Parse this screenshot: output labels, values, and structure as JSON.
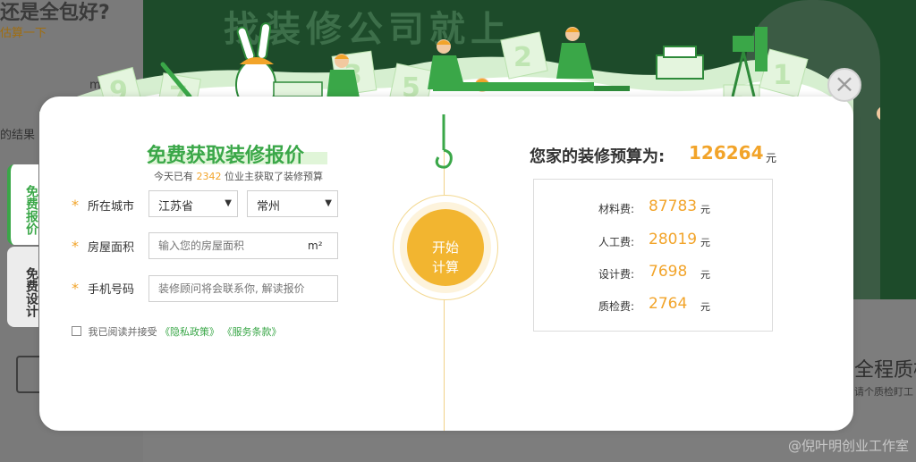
{
  "background": {
    "title": "还是全包好?",
    "subtitle": "估算一下",
    "area_unit": "m²",
    "result_text": "的结果",
    "banner_text": "找装修公司就上",
    "quality_title": "全程质检",
    "quality_sub": "请个质检盯工",
    "watermark": "@倪叶明创业工作室"
  },
  "side_tabs": [
    {
      "label": "免费报价"
    },
    {
      "label": "免费设计"
    }
  ],
  "form": {
    "title": "免费获取装修报价",
    "sub_prefix": "今天已有",
    "sub_count": "2342",
    "sub_suffix": "位业主获取了装修预算",
    "city_label": "所在城市",
    "province_value": "江苏省",
    "city_value": "常州",
    "area_label": "房屋面积",
    "area_placeholder": "输入您的房屋面积",
    "area_unit": "m²",
    "phone_label": "手机号码",
    "phone_placeholder": "装修顾问将会联系你, 解读报价",
    "agree_text": "我已阅读并接受",
    "privacy_link": "《隐私政策》",
    "terms_link": "《服务条款》"
  },
  "calc": {
    "line1": "开始",
    "line2": "计算"
  },
  "result": {
    "budget_label": "您家的装修预算为:",
    "budget_value": "126264",
    "unit": "元",
    "items": [
      {
        "label": "材料费:",
        "value": "87783",
        "unit": "元"
      },
      {
        "label": "人工费:",
        "value": "28019",
        "unit": "元"
      },
      {
        "label": "设计费:",
        "value": "7698",
        "unit": "元"
      },
      {
        "label": "质检费:",
        "value": "2764",
        "unit": "元"
      }
    ]
  },
  "close_label": "×",
  "colors": {
    "accent_green": "#3aa748",
    "accent_orange": "#f2a42a",
    "button_yellow": "#f2b530"
  }
}
